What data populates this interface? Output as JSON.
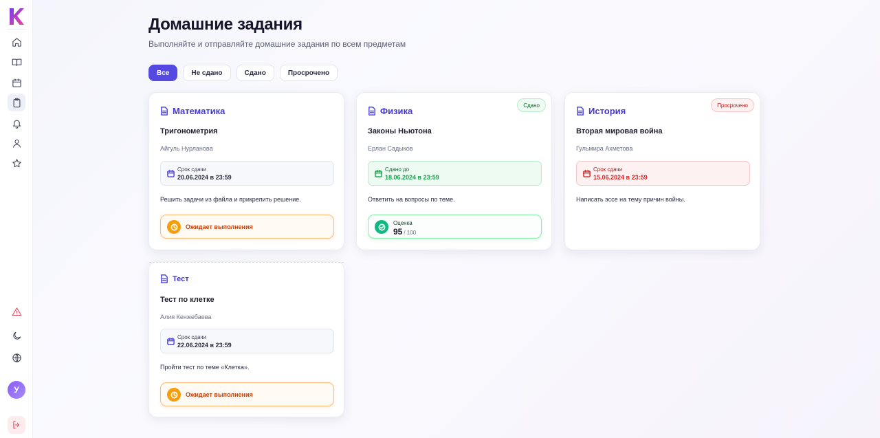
{
  "app": {
    "logo_letter": "K",
    "logo_colors": [
      "#7c3aed",
      "#ec4899"
    ]
  },
  "sidebar": {
    "nav": [
      {
        "name": "home-icon",
        "active": false
      },
      {
        "name": "book-icon",
        "active": false
      },
      {
        "name": "calendar-icon",
        "active": false
      },
      {
        "name": "clipboard-icon",
        "active": true
      },
      {
        "name": "bell-icon",
        "active": false
      },
      {
        "name": "user-icon",
        "active": false
      },
      {
        "name": "star-icon",
        "active": false
      }
    ],
    "bottom": [
      "alert-triangle-icon",
      "moon-icon",
      "globe-icon"
    ],
    "avatar_letter": "У",
    "logout_icon": "logout-icon"
  },
  "header": {
    "title": "Домашние задания",
    "subtitle": "Выполняйте и отправляйте домашние задания по всем предметам"
  },
  "filters": {
    "tabs": [
      "Все",
      "Не сдано",
      "Сдано",
      "Просрочено"
    ],
    "active": "Все"
  },
  "cards": [
    {
      "subject": "Математика",
      "title": "Тригонометрия",
      "teacher": "Айгуль Нурланова",
      "deadline_label": "Срок сдачи",
      "deadline_value": "20.06.2024 в 23:59",
      "description": "Решить задачи из файла и прикрепить решение.",
      "status": "Ожидает выполнения"
    },
    {
      "subject": "Физика",
      "badge": "Сдано",
      "title": "Законы Ньютона",
      "teacher": "Ерлан Садыков",
      "deadline_label": "Сдано до",
      "deadline_value": "18.06.2024 в 23:59",
      "description": "Ответить на вопросы по теме.",
      "grade_label": "Оценка",
      "grade_value": "95",
      "grade_max": "/ 100"
    },
    {
      "subject": "История",
      "badge": "Просрочено",
      "title": "Вторая мировая война",
      "teacher": "Гульмира Ахметова",
      "deadline_label": "Срок сдачи",
      "deadline_value": "15.06.2024 в 23:59",
      "description": "Написать эссе на тему причин войны."
    },
    {
      "subject": "Тест",
      "title": "Тест по клетке",
      "teacher": "Алия Кенжебаева",
      "deadline_label": "Срок сдачи",
      "deadline_value": "22.06.2024 в 23:59",
      "description": "Пройти тест по теме «Клетка».",
      "status": "Ожидает выполнения"
    }
  ],
  "colors": {
    "accent": "#5449e0",
    "subject": "#4338ca",
    "pending": "#f59e0b",
    "success": "#16a34a",
    "danger": "#dc2626"
  }
}
